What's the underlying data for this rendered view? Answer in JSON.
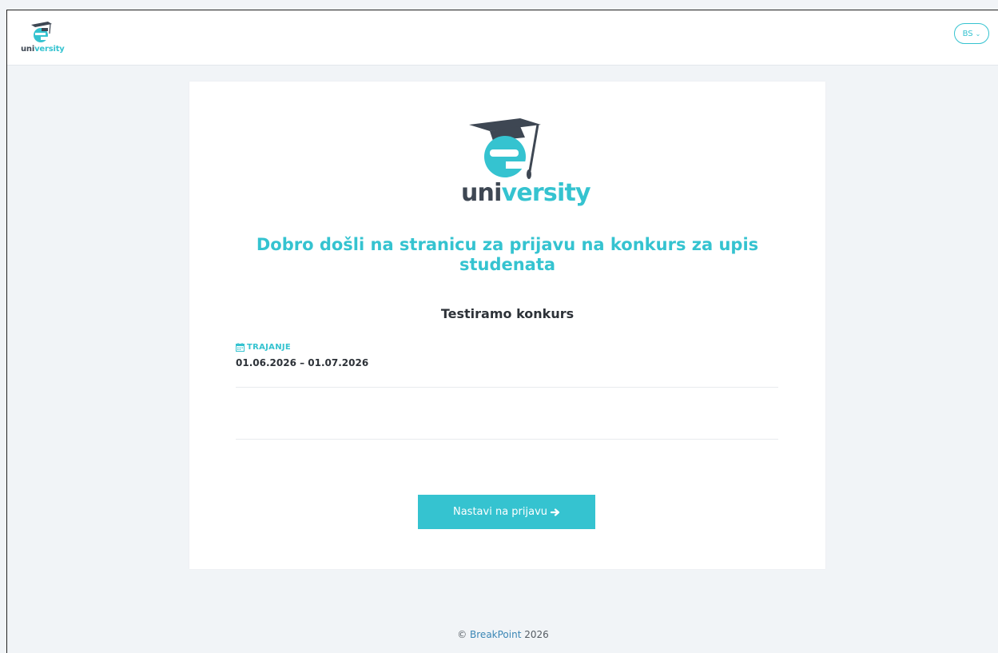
{
  "brand": {
    "word_dark": "uni",
    "word_teal": "versity",
    "accent_color": "#35c3d0",
    "dark_color": "#3e4753",
    "icon": "graduation-cap-e-logo"
  },
  "header": {
    "language": "BS",
    "language_icon": "chevron-down-icon"
  },
  "main": {
    "welcome": "Dobro došli na stranicu za prijavu na konkurs za upis studenata",
    "contest_name": "Testiramo konkurs",
    "duration_label": "TRAJANJE",
    "duration_icon": "calendar-icon",
    "duration_value": "01.06.2026 – 01.07.2026",
    "cta_label": "Nastavi na prijavu",
    "cta_icon": "arrow-right-icon"
  },
  "footer": {
    "copyright": "©",
    "company": "BreakPoint",
    "year": "2026"
  }
}
